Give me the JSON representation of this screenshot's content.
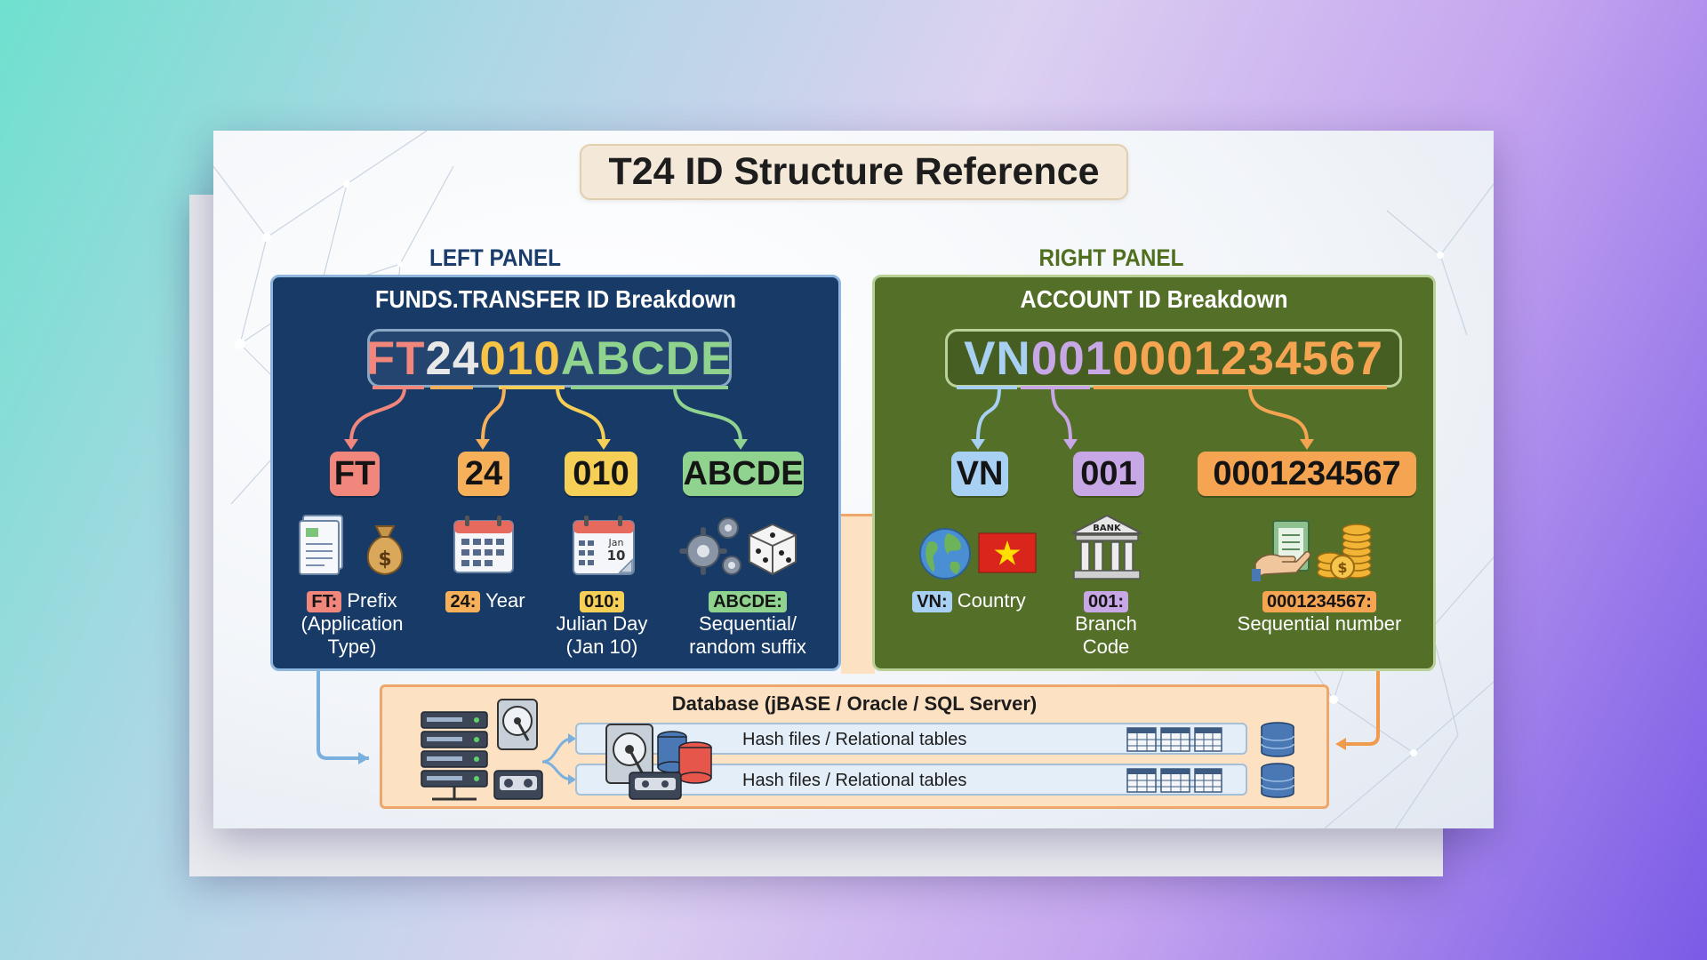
{
  "title": "T24 ID Structure Reference",
  "left_panel": {
    "label": "LEFT PANEL",
    "heading": "FUNDS.TRANSFER ID Breakdown",
    "id_segments": [
      "FT",
      "24",
      "010",
      "ABCDE"
    ],
    "chips": [
      "FT",
      "24",
      "010",
      "ABCDE"
    ],
    "descriptions": [
      {
        "tag": "FT:",
        "text": "Prefix",
        "text2": "(Application",
        "text3": "Type)"
      },
      {
        "tag": "24:",
        "text": "Year"
      },
      {
        "tag": "010:",
        "text": "Julian Day",
        "text2": "(Jan 10)"
      },
      {
        "tag": "ABCDE:",
        "text": "Sequential/",
        "text2": "random suffix"
      }
    ],
    "calendar_text": {
      "month": "Jan",
      "day": "10"
    }
  },
  "right_panel": {
    "label": "RIGHT PANEL",
    "heading": "ACCOUNT ID Breakdown",
    "id_segments": [
      "VN",
      "001",
      "0001234567"
    ],
    "chips": [
      "VN",
      "001",
      "0001234567"
    ],
    "descriptions": [
      {
        "tag": "VN:",
        "text": "Country"
      },
      {
        "tag": "001:",
        "text": "Branch",
        "text2": "Code"
      },
      {
        "tag": "0001234567:",
        "text": "Sequential number"
      }
    ],
    "bank_text": "BANK"
  },
  "database": {
    "title": "Database (jBASE / Oracle / SQL Server)",
    "rows": [
      "Hash files / Relational tables",
      "Hash files / Relational tables"
    ]
  },
  "colors": {
    "ft": "#f0867c",
    "year": "#f7b05a",
    "julian": "#f6cf57",
    "suffix": "#8fd38f",
    "country": "#a8d0f2",
    "branch": "#c7a7e6",
    "account": "#f5a552",
    "left_panel_bg": "#173a66",
    "right_panel_bg": "#536f28",
    "db_bg": "#fde1c3"
  },
  "icons": [
    "document-icon",
    "money-bag-icon",
    "calendar-icon",
    "julian-calendar-icon",
    "gears-icon",
    "dice-icon",
    "globe-icon",
    "vietnam-flag-icon",
    "bank-icon",
    "ledger-icon",
    "coins-icon",
    "server-icon",
    "hard-disk-icon",
    "tape-icon",
    "database-icon",
    "table-icon"
  ]
}
